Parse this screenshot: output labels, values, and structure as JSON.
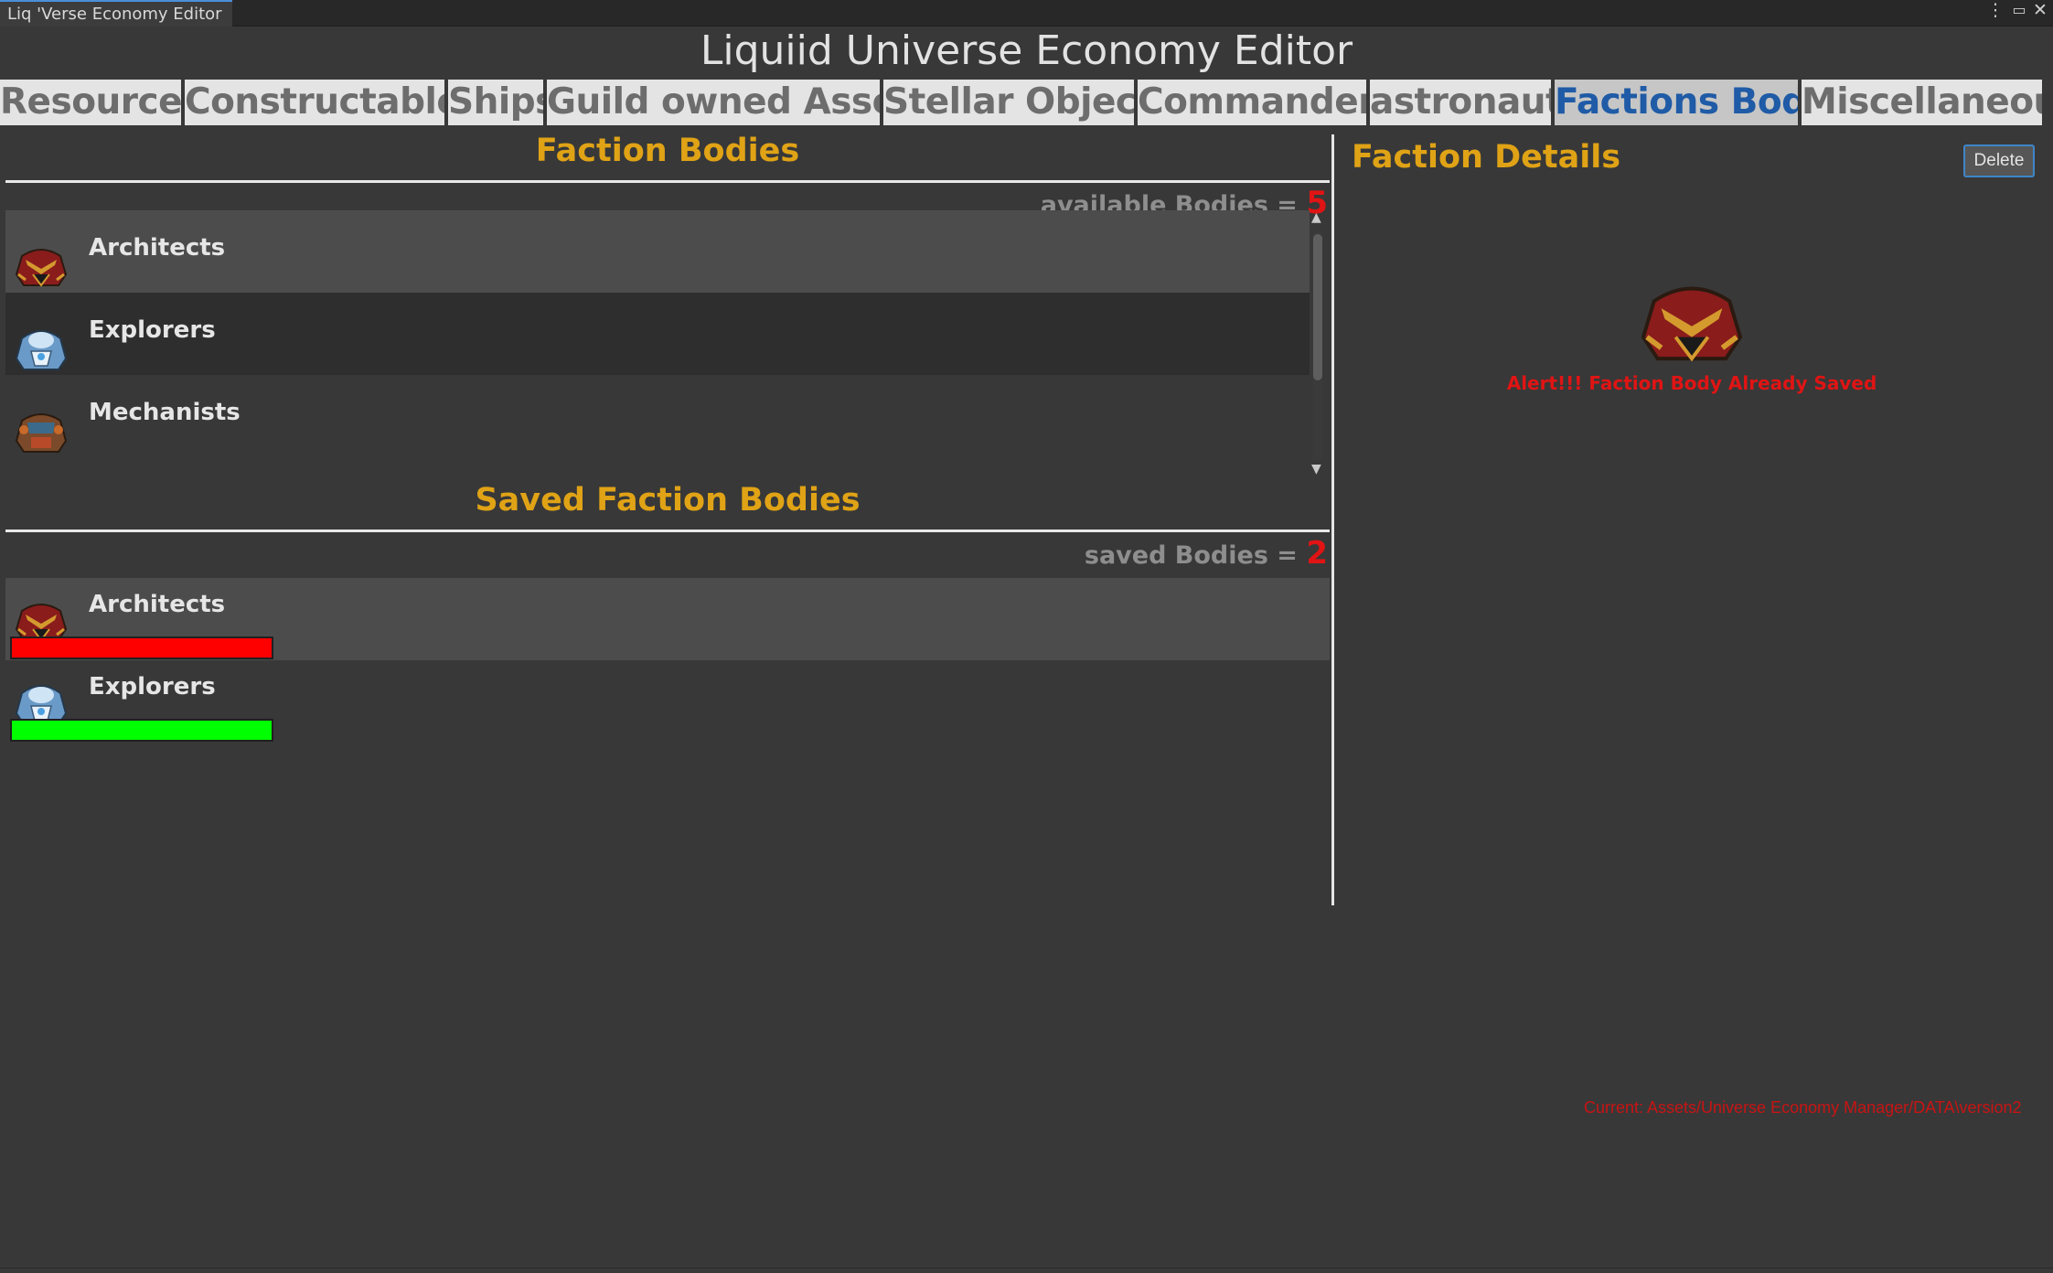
{
  "window": {
    "tab_title": "Liq 'Verse Economy Editor",
    "menu_icon": "kebab-menu-icon",
    "maximize_icon": "maximize-icon",
    "close_icon": "close-icon"
  },
  "app_title": "Liquiid Universe Economy Editor",
  "tabs": [
    {
      "label": "Resources",
      "active": false
    },
    {
      "label": "Constructables",
      "active": false
    },
    {
      "label": "Ships",
      "active": false
    },
    {
      "label": "Guild owned Assets",
      "active": false
    },
    {
      "label": "Stellar Objects",
      "active": false
    },
    {
      "label": "Commanders",
      "active": false
    },
    {
      "label": "astronauts",
      "active": false
    },
    {
      "label": "Factions Body",
      "active": true
    },
    {
      "label": "Miscellaneous",
      "active": false
    }
  ],
  "available": {
    "title": "Faction Bodies",
    "count_label": "available Bodies = ",
    "count": "5",
    "items": [
      {
        "label": "Architects",
        "icon": "architects-armor-icon"
      },
      {
        "label": "Explorers",
        "icon": "explorers-armor-icon"
      },
      {
        "label": "Mechanists",
        "icon": "mechanists-armor-icon"
      }
    ]
  },
  "saved": {
    "title": "Saved Faction Bodies",
    "count_label": "saved Bodies = ",
    "count": "2",
    "items": [
      {
        "label": "Architects",
        "icon": "architects-armor-icon",
        "status_color": "#ff0000"
      },
      {
        "label": "Explorers",
        "icon": "explorers-armor-icon",
        "status_color": "#00ff00"
      }
    ]
  },
  "details": {
    "title": "Faction Details",
    "delete_label": "Delete",
    "icon": "architects-armor-icon",
    "alert": "Alert!!! Faction  Body Already Saved"
  },
  "footer": {
    "path": "Current: Assets/Universe Economy Manager/DATA\\version2"
  },
  "colors": {
    "accent": "#e0a316",
    "alert": "#e01414",
    "active_tab_text": "#1f5ba6"
  }
}
